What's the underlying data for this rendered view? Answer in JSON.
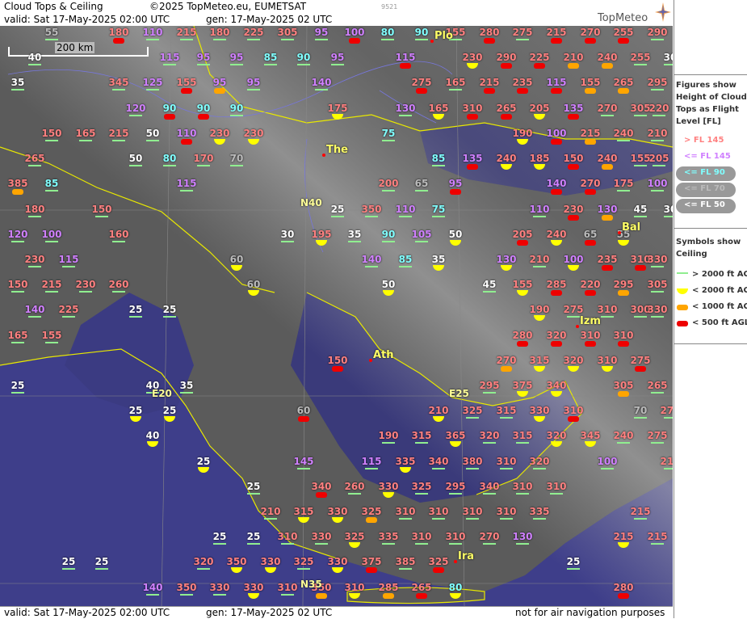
{
  "header": {
    "title": "Cloud Tops & Ceiling",
    "copyright": "©2025 TopMeteo.eu, EUMETSAT",
    "code": "9521",
    "valid": "valid:  Sat  17-May-2025  02:00 UTC",
    "gen": "gen: 17-May-2025 02 UTC",
    "brand": "TopMeteo"
  },
  "footer": {
    "valid": "valid:  Sat  17-May-2025  02:00 UTC",
    "gen": "gen: 17-May-2025 02 UTC",
    "disclaimer": "not for air navigation purposes"
  },
  "scale": {
    "label": "200 km"
  },
  "legend": {
    "heading1": [
      "Figures show",
      "Height of Cloud",
      "Tops as Flight",
      "Level  [FL]"
    ],
    "items": [
      {
        "label": "> FL 145",
        "color": "#ff8080"
      },
      {
        "label": "<= FL 145",
        "color": "#d080ff"
      },
      {
        "label": "<= FL 90",
        "color": "#80ffff"
      },
      {
        "label": "<= FL 70",
        "color": "#bbbbbb"
      },
      {
        "label": "<= FL 50",
        "color": "#ffffff"
      }
    ],
    "heading2": [
      "Symbols show",
      "Ceiling"
    ],
    "symbols": [
      {
        "label": "> 2000 ft AGL",
        "kind": "g"
      },
      {
        "label": "< 2000 ft AGL",
        "kind": "y"
      },
      {
        "label": "< 1000 ft AGL",
        "kind": "o"
      },
      {
        "label": "< 500 ft AGL",
        "kind": "r"
      }
    ]
  },
  "colors": {
    "gt145": "#ff8080",
    "le145": "#d080ff",
    "le90": "#80ffff",
    "le70": "#bbbbbb",
    "le50": "#ffffff",
    "sea": "#3c3c8c",
    "land": "#5a5a5a",
    "coast": "#e8e800"
  },
  "places": [
    {
      "name": "Plo"
    },
    {
      "name": "The"
    },
    {
      "name": "Ath"
    },
    {
      "name": "Izm"
    },
    {
      "name": "Bal"
    },
    {
      "name": "Ira"
    }
  ],
  "gridlabels": [
    {
      "text": "N40"
    },
    {
      "text": "E20"
    },
    {
      "text": "E25"
    },
    {
      "text": "N35"
    }
  ],
  "markers": [
    {
      "v": "55"
    },
    {
      "v": "180",
      "s": "r"
    },
    {
      "v": "110"
    },
    {
      "v": "215"
    },
    {
      "v": "180"
    },
    {
      "v": "225"
    },
    {
      "v": "305"
    },
    {
      "v": "95"
    },
    {
      "v": "100",
      "s": "r"
    },
    {
      "v": "80"
    },
    {
      "v": "90"
    },
    {
      "v": "155"
    },
    {
      "v": "280",
      "s": "r"
    },
    {
      "v": "275"
    },
    {
      "v": "215",
      "s": "r"
    },
    {
      "v": "270",
      "s": "r"
    },
    {
      "v": "255",
      "s": "r"
    },
    {
      "v": "290"
    },
    {
      "v": "40"
    },
    {
      "v": "115"
    },
    {
      "v": "95"
    },
    {
      "v": "95"
    },
    {
      "v": "85"
    },
    {
      "v": "90"
    },
    {
      "v": "95"
    },
    {
      "v": "115",
      "s": "r"
    },
    {
      "v": "230",
      "s": "y"
    },
    {
      "v": "290",
      "s": "r"
    },
    {
      "v": "225",
      "s": "r"
    },
    {
      "v": "210",
      "s": "o"
    },
    {
      "v": "240",
      "s": "o"
    },
    {
      "v": "255"
    },
    {
      "v": "30"
    },
    {
      "v": "35"
    },
    {
      "v": "345"
    },
    {
      "v": "125"
    },
    {
      "v": "155",
      "s": "r"
    },
    {
      "v": "95",
      "s": "o"
    },
    {
      "v": "95"
    },
    {
      "v": "140"
    },
    {
      "v": "275",
      "s": "r"
    },
    {
      "v": "165"
    },
    {
      "v": "215",
      "s": "r"
    },
    {
      "v": "235",
      "s": "r"
    },
    {
      "v": "115",
      "s": "r"
    },
    {
      "v": "155",
      "s": "o"
    },
    {
      "v": "265",
      "s": "o"
    },
    {
      "v": "295"
    },
    {
      "v": "120"
    },
    {
      "v": "90",
      "s": "r"
    },
    {
      "v": "90",
      "s": "r"
    },
    {
      "v": "90"
    },
    {
      "v": "175",
      "s": "y"
    },
    {
      "v": "130"
    },
    {
      "v": "165",
      "s": "y"
    },
    {
      "v": "310",
      "s": "r"
    },
    {
      "v": "265",
      "s": "r"
    },
    {
      "v": "205",
      "s": "y"
    },
    {
      "v": "135",
      "s": "r"
    },
    {
      "v": "270"
    },
    {
      "v": "305"
    },
    {
      "v": "220"
    },
    {
      "v": "150"
    },
    {
      "v": "165"
    },
    {
      "v": "215"
    },
    {
      "v": "50"
    },
    {
      "v": "110",
      "s": "r"
    },
    {
      "v": "230",
      "s": "y"
    },
    {
      "v": "230",
      "s": "y"
    },
    {
      "v": "75"
    },
    {
      "v": "190",
      "s": "y"
    },
    {
      "v": "100",
      "s": "r"
    },
    {
      "v": "215",
      "s": "o"
    },
    {
      "v": "240"
    },
    {
      "v": "210"
    },
    {
      "v": "265"
    },
    {
      "v": "50"
    },
    {
      "v": "80"
    },
    {
      "v": "170"
    },
    {
      "v": "70"
    },
    {
      "v": "85"
    },
    {
      "v": "135",
      "s": "r"
    },
    {
      "v": "240",
      "s": "y"
    },
    {
      "v": "185",
      "s": "y"
    },
    {
      "v": "150",
      "s": "r"
    },
    {
      "v": "240",
      "s": "o"
    },
    {
      "v": "155"
    },
    {
      "v": "205"
    },
    {
      "v": "385",
      "s": "o"
    },
    {
      "v": "85"
    },
    {
      "v": "115"
    },
    {
      "v": "200"
    },
    {
      "v": "65"
    },
    {
      "v": "95",
      "s": "r"
    },
    {
      "v": "140",
      "s": "r"
    },
    {
      "v": "270",
      "s": "r"
    },
    {
      "v": "175"
    },
    {
      "v": "100"
    },
    {
      "v": "180"
    },
    {
      "v": "150"
    },
    {
      "v": "25"
    },
    {
      "v": "350"
    },
    {
      "v": "110"
    },
    {
      "v": "75"
    },
    {
      "v": "110"
    },
    {
      "v": "230",
      "s": "r"
    },
    {
      "v": "130",
      "s": "o"
    },
    {
      "v": "45"
    },
    {
      "v": "30"
    },
    {
      "v": "120"
    },
    {
      "v": "100"
    },
    {
      "v": "160"
    },
    {
      "v": "30"
    },
    {
      "v": "195",
      "s": "y"
    },
    {
      "v": "35"
    },
    {
      "v": "90"
    },
    {
      "v": "105"
    },
    {
      "v": "50",
      "s": "y"
    },
    {
      "v": "205",
      "s": "r"
    },
    {
      "v": "240",
      "s": "y"
    },
    {
      "v": "65",
      "s": "r"
    },
    {
      "v": "55",
      "s": "y"
    },
    {
      "v": "230"
    },
    {
      "v": "115"
    },
    {
      "v": "60",
      "s": "y"
    },
    {
      "v": "140"
    },
    {
      "v": "85"
    },
    {
      "v": "35",
      "s": "y"
    },
    {
      "v": "130",
      "s": "y"
    },
    {
      "v": "210"
    },
    {
      "v": "100",
      "s": "y"
    },
    {
      "v": "235",
      "s": "r"
    },
    {
      "v": "310",
      "s": "r"
    },
    {
      "v": "330"
    },
    {
      "v": "150"
    },
    {
      "v": "215"
    },
    {
      "v": "230"
    },
    {
      "v": "260"
    },
    {
      "v": "60",
      "s": "y"
    },
    {
      "v": "50",
      "s": "y"
    },
    {
      "v": "45"
    },
    {
      "v": "155",
      "s": "y"
    },
    {
      "v": "285",
      "s": "r"
    },
    {
      "v": "220",
      "s": "r"
    },
    {
      "v": "295",
      "s": "o"
    },
    {
      "v": "305"
    },
    {
      "v": "140"
    },
    {
      "v": "225"
    },
    {
      "v": "25"
    },
    {
      "v": "25"
    },
    {
      "v": "190",
      "s": "y"
    },
    {
      "v": "275"
    },
    {
      "v": "310"
    },
    {
      "v": "300"
    },
    {
      "v": "330"
    },
    {
      "v": "165"
    },
    {
      "v": "155"
    },
    {
      "v": "280",
      "s": "r"
    },
    {
      "v": "320",
      "s": "r"
    },
    {
      "v": "310",
      "s": "r"
    },
    {
      "v": "310",
      "s": "r"
    },
    {
      "v": "150",
      "s": "r"
    },
    {
      "v": "270",
      "s": "o"
    },
    {
      "v": "315",
      "s": "y"
    },
    {
      "v": "320",
      "s": "y"
    },
    {
      "v": "310",
      "s": "y"
    },
    {
      "v": "275",
      "s": "r"
    },
    {
      "v": "25"
    },
    {
      "v": "40"
    },
    {
      "v": "35"
    },
    {
      "v": "295"
    },
    {
      "v": "375",
      "s": "y"
    },
    {
      "v": "340",
      "s": "y"
    },
    {
      "v": "305",
      "s": "o"
    },
    {
      "v": "265"
    },
    {
      "v": "25",
      "s": "y"
    },
    {
      "v": "25",
      "s": "y"
    },
    {
      "v": "60",
      "s": "r"
    },
    {
      "v": "210",
      "s": "y"
    },
    {
      "v": "325"
    },
    {
      "v": "315"
    },
    {
      "v": "330",
      "s": "y"
    },
    {
      "v": "310",
      "s": "r"
    },
    {
      "v": "70"
    },
    {
      "v": "275"
    },
    {
      "v": "40",
      "s": "y"
    },
    {
      "v": "190"
    },
    {
      "v": "315"
    },
    {
      "v": "365",
      "s": "y"
    },
    {
      "v": "320"
    },
    {
      "v": "315"
    },
    {
      "v": "320",
      "s": "y"
    },
    {
      "v": "345",
      "s": "y"
    },
    {
      "v": "240"
    },
    {
      "v": "275"
    },
    {
      "v": "25",
      "s": "y"
    },
    {
      "v": "145"
    },
    {
      "v": "115"
    },
    {
      "v": "335",
      "s": "y"
    },
    {
      "v": "340"
    },
    {
      "v": "380"
    },
    {
      "v": "310"
    },
    {
      "v": "320"
    },
    {
      "v": "100"
    },
    {
      "v": "210"
    },
    {
      "v": "25"
    },
    {
      "v": "340",
      "s": "r"
    },
    {
      "v": "260"
    },
    {
      "v": "330",
      "s": "y"
    },
    {
      "v": "325"
    },
    {
      "v": "295"
    },
    {
      "v": "340"
    },
    {
      "v": "310"
    },
    {
      "v": "310"
    },
    {
      "v": "210"
    },
    {
      "v": "315",
      "s": "y"
    },
    {
      "v": "330",
      "s": "y"
    },
    {
      "v": "325",
      "s": "o"
    },
    {
      "v": "310"
    },
    {
      "v": "310"
    },
    {
      "v": "310"
    },
    {
      "v": "310"
    },
    {
      "v": "335"
    },
    {
      "v": "215"
    },
    {
      "v": "25"
    },
    {
      "v": "25"
    },
    {
      "v": "310"
    },
    {
      "v": "330"
    },
    {
      "v": "325",
      "s": "y"
    },
    {
      "v": "335"
    },
    {
      "v": "310"
    },
    {
      "v": "310"
    },
    {
      "v": "270"
    },
    {
      "v": "130"
    },
    {
      "v": "215",
      "s": "y"
    },
    {
      "v": "215"
    },
    {
      "v": "25"
    },
    {
      "v": "25"
    },
    {
      "v": "320"
    },
    {
      "v": "350",
      "s": "y"
    },
    {
      "v": "330",
      "s": "y"
    },
    {
      "v": "325"
    },
    {
      "v": "330",
      "s": "y"
    },
    {
      "v": "375",
      "s": "r"
    },
    {
      "v": "385"
    },
    {
      "v": "325",
      "s": "r"
    },
    {
      "v": "25"
    },
    {
      "v": "140"
    },
    {
      "v": "350"
    },
    {
      "v": "330"
    },
    {
      "v": "330",
      "s": "y"
    },
    {
      "v": "310"
    },
    {
      "v": "350",
      "s": "o"
    },
    {
      "v": "310",
      "s": "y"
    },
    {
      "v": "285",
      "s": "o"
    },
    {
      "v": "265",
      "s": "r"
    },
    {
      "v": "80",
      "s": "y"
    },
    {
      "v": "280",
      "s": "r"
    }
  ]
}
